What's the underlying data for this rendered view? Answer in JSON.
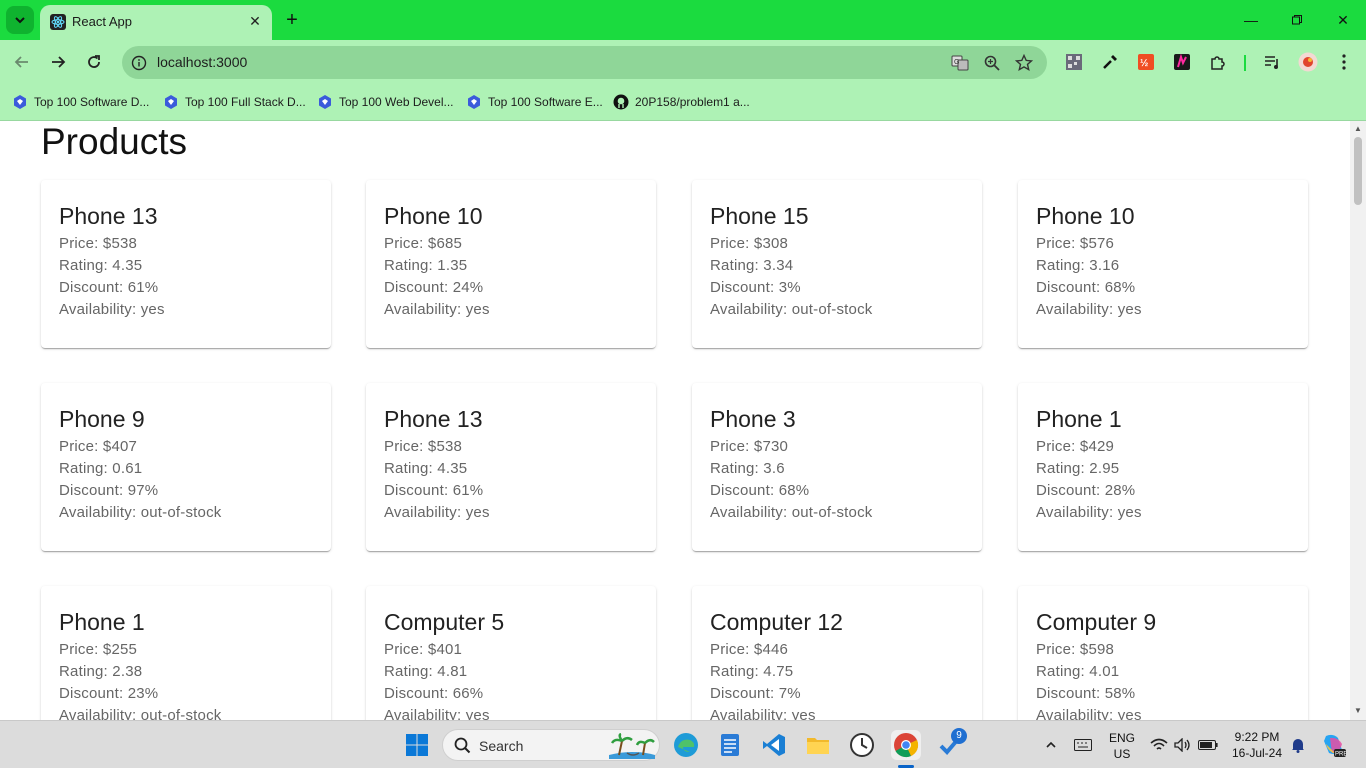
{
  "browser": {
    "tab_title": "React App",
    "url": "localhost:3000",
    "bookmarks": [
      "Top 100 Software D...",
      "Top 100 Full Stack D...",
      "Top 100 Web Devel...",
      "Top 100 Software E...",
      "20P158/problem1 a..."
    ]
  },
  "page": {
    "title": "Products"
  },
  "products": [
    {
      "name": "Phone 13",
      "price": "Price: $538",
      "rating": "Rating: 4.35",
      "discount": "Discount: 61%",
      "availability": "Availability: yes"
    },
    {
      "name": "Phone 10",
      "price": "Price: $685",
      "rating": "Rating: 1.35",
      "discount": "Discount: 24%",
      "availability": "Availability: yes"
    },
    {
      "name": "Phone 15",
      "price": "Price: $308",
      "rating": "Rating: 3.34",
      "discount": "Discount: 3%",
      "availability": "Availability: out-of-stock"
    },
    {
      "name": "Phone 10",
      "price": "Price: $576",
      "rating": "Rating: 3.16",
      "discount": "Discount: 68%",
      "availability": "Availability: yes"
    },
    {
      "name": "Phone 9",
      "price": "Price: $407",
      "rating": "Rating: 0.61",
      "discount": "Discount: 97%",
      "availability": "Availability: out-of-stock"
    },
    {
      "name": "Phone 13",
      "price": "Price: $538",
      "rating": "Rating: 4.35",
      "discount": "Discount: 61%",
      "availability": "Availability: yes"
    },
    {
      "name": "Phone 3",
      "price": "Price: $730",
      "rating": "Rating: 3.6",
      "discount": "Discount: 68%",
      "availability": "Availability: out-of-stock"
    },
    {
      "name": "Phone 1",
      "price": "Price: $429",
      "rating": "Rating: 2.95",
      "discount": "Discount: 28%",
      "availability": "Availability: yes"
    },
    {
      "name": "Phone 1",
      "price": "Price: $255",
      "rating": "Rating: 2.38",
      "discount": "Discount: 23%",
      "availability": "Availability: out-of-stock"
    },
    {
      "name": "Computer 5",
      "price": "Price: $401",
      "rating": "Rating: 4.81",
      "discount": "Discount: 66%",
      "availability": "Availability: yes"
    },
    {
      "name": "Computer 12",
      "price": "Price: $446",
      "rating": "Rating: 4.75",
      "discount": "Discount: 7%",
      "availability": "Availability: yes"
    },
    {
      "name": "Computer 9",
      "price": "Price: $598",
      "rating": "Rating: 4.01",
      "discount": "Discount: 58%",
      "availability": "Availability: yes"
    }
  ],
  "taskbar": {
    "search_placeholder": "Search",
    "language_line1": "ENG",
    "language_line2": "US",
    "time": "9:22 PM",
    "date": "16-Jul-24",
    "todo_badge": "9"
  },
  "colors": {
    "tab_strip": "#1bdb3f",
    "toolbar": "#aef2b5",
    "omnibox": "#8fd698"
  }
}
